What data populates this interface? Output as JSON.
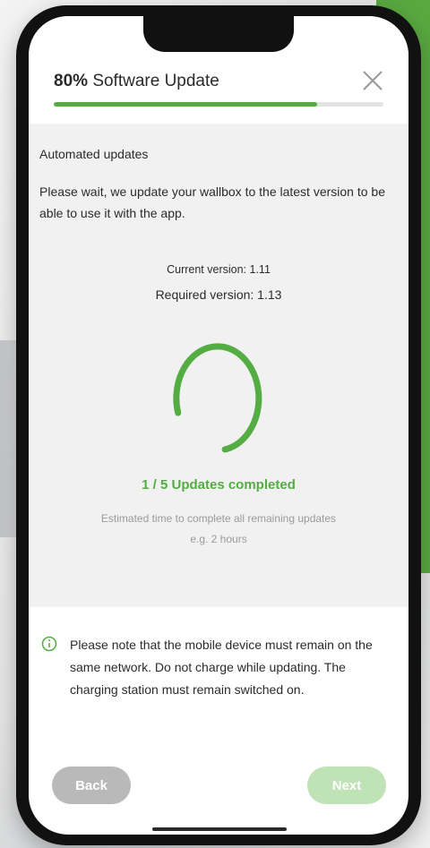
{
  "header": {
    "progress_percent_label": "80%",
    "title": "Software Update",
    "progress": 0.8
  },
  "content": {
    "section_label": "Automated updates",
    "intro": "Please wait, we update your wallbox to the latest version to be able to use it with the app.",
    "current_version": "Current version: 1.11",
    "required_version": "Required version: 1.13",
    "updates_completed": "1 / 5 Updates completed",
    "estimate_text": "Estimated time to complete all remaining updates",
    "estimate_value": "e.g. 2 hours"
  },
  "notice": {
    "text": "Please note that the mobile device must remain on the same network. Do not charge while updating. The charging station must remain switched on."
  },
  "buttons": {
    "back_label": "Back",
    "next_label": "Next"
  },
  "colors": {
    "accent": "#53ad43",
    "next_disabled": "#bfe2b6",
    "back": "#b9b9b9",
    "content_bg": "#f1f1f1"
  },
  "icons": {
    "close": "close-icon",
    "info": "info-icon",
    "progress": "progress-ring-icon"
  }
}
